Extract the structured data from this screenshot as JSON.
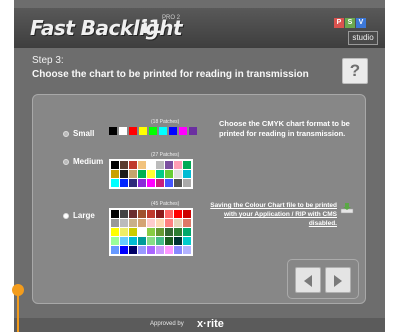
{
  "app": {
    "brand": "Fast Backlight",
    "brand_mark": "i1",
    "brand_tag": "PRO 2",
    "studio_logo": {
      "letters": [
        "P",
        "S",
        "V"
      ],
      "word": "studio",
      "colors": [
        "#d9534f",
        "#6aa84f",
        "#3c78d8"
      ]
    }
  },
  "step": {
    "label": "Step 3:",
    "instruction": "Choose the chart to be printed for reading in transmission"
  },
  "help_button_label": "?",
  "options": [
    {
      "label": "Small",
      "patch_count": "(18 Patches)",
      "selected": false
    },
    {
      "label": "Medium",
      "patch_count": "(27 Patches)",
      "selected": false
    },
    {
      "label": "Large",
      "patch_count": "(45 Patches)",
      "selected": true
    }
  ],
  "charts": {
    "small": [
      "#000000",
      "#ffffff",
      "#ff0000",
      "#ffff00",
      "#00ff00",
      "#00ffff",
      "#0000ff",
      "#ff00ff",
      "#6b2fa0"
    ],
    "medium": [
      "#000000",
      "#5a3b2e",
      "#c0392b",
      "#f1c27d",
      "#ffffff",
      "#bbbbbb",
      "#7b4fa0",
      "#ff9eb5",
      "#00aa55",
      "#c9a000",
      "#1b1b1b",
      "#c4a46c",
      "#00b050",
      "#ffff33",
      "#00cc88",
      "#66cc33",
      "#e0e0e0",
      "#00bcd4",
      "#00ffff",
      "#0026ff",
      "#2e2a7a",
      "#8b2bd8",
      "#ff00ff",
      "#c81d7b",
      "#4455ff",
      "#555555",
      "#aaaaaa"
    ],
    "large": [
      "#000000",
      "#444444",
      "#6b2f2f",
      "#a0522d",
      "#c0392b",
      "#8b1a1a",
      "#ff6666",
      "#ff0000",
      "#cc0000",
      "#999999",
      "#bbbbbb",
      "#c9b08a",
      "#d4a373",
      "#ffcccc",
      "#ffd9b3",
      "#ff8080",
      "#e6d5b8",
      "#dd7766",
      "#ffff00",
      "#eeee66",
      "#cccc00",
      "#ffffff",
      "#88cc44",
      "#669933",
      "#336633",
      "#2e7d32",
      "#00a86b",
      "#99ff99",
      "#66ccff",
      "#00bcd4",
      "#009999",
      "#88dd88",
      "#44bb88",
      "#1b5e20",
      "#003333",
      "#00cccc",
      "#6699ff",
      "#0000ff",
      "#000066",
      "#9999ff",
      "#aa66ff",
      "#cc99ff",
      "#ff99ff",
      "#8888ff",
      "#b3b3ff"
    ]
  },
  "description": "Choose the CMYK chart format to be printed for reading in transmission.",
  "save_link": "Saving the Colour Chart file to be printed with your Application / RIP with CMS disabled.",
  "footer": {
    "prefix": "Approved by",
    "brand": "x·rite"
  }
}
